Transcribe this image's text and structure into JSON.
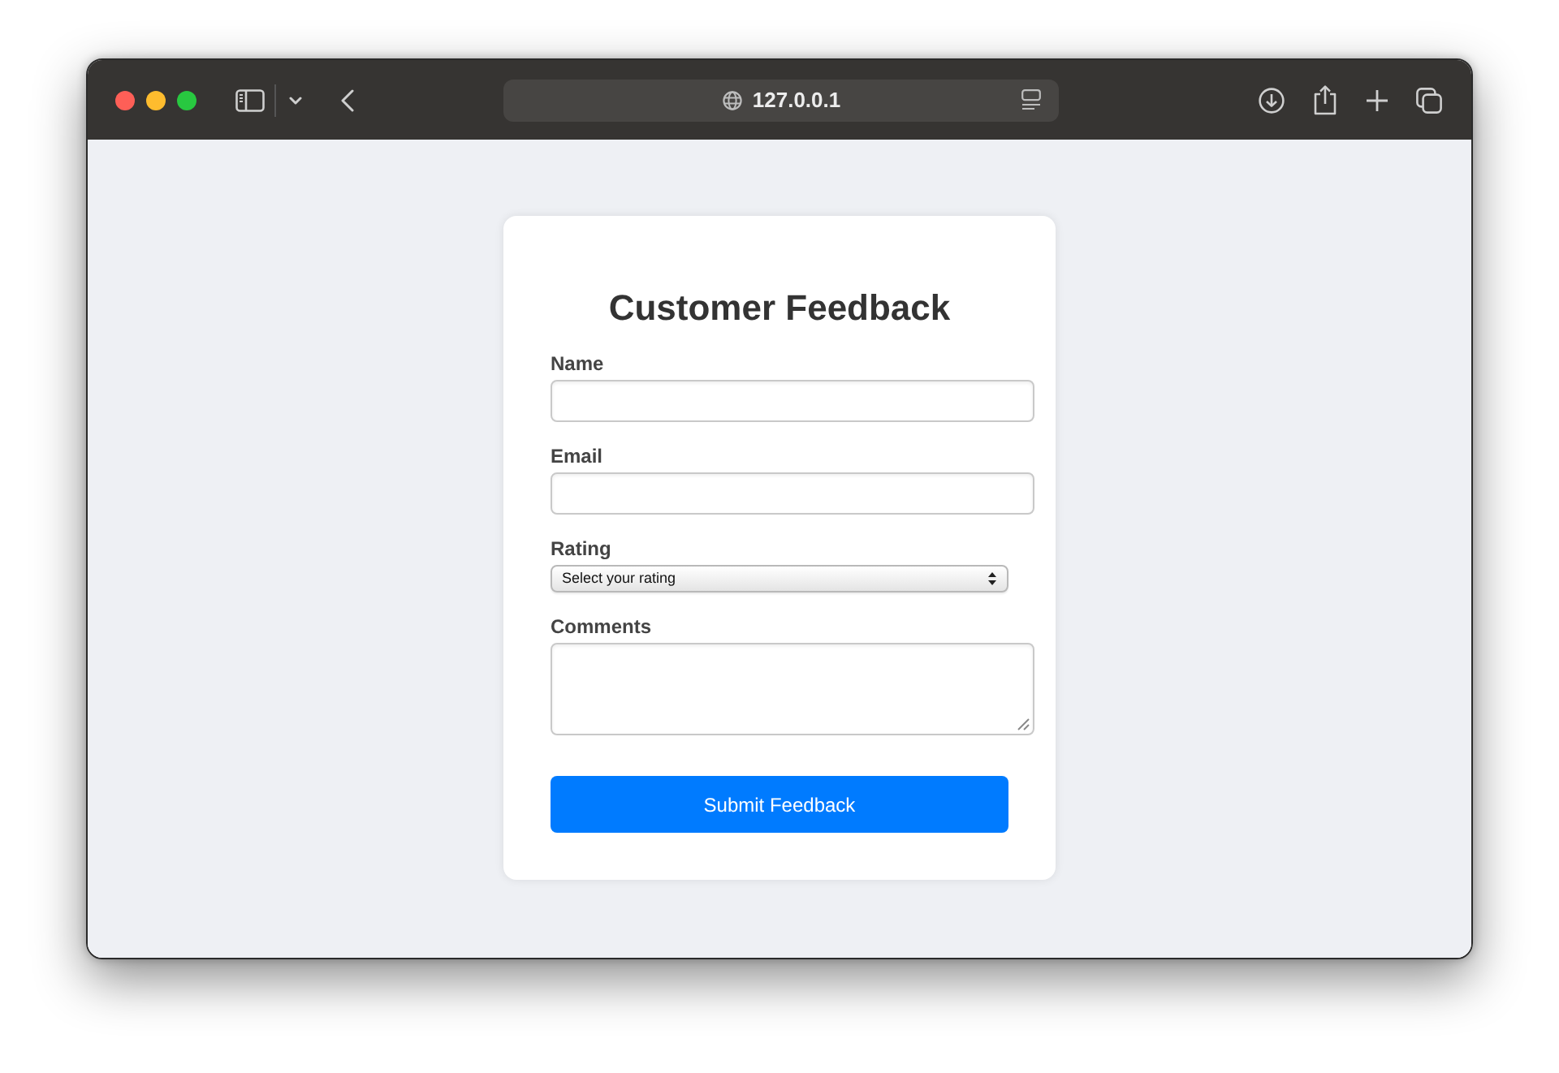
{
  "browser": {
    "url": "127.0.0.1"
  },
  "form": {
    "title": "Customer Feedback",
    "fields": [
      {
        "kind": "input",
        "label": "Name"
      },
      {
        "kind": "input",
        "label": "Email"
      },
      {
        "kind": "select",
        "label": "Rating",
        "value": "Select your rating"
      },
      {
        "kind": "textarea",
        "label": "Comments"
      }
    ],
    "submit": "Submit Feedback"
  }
}
